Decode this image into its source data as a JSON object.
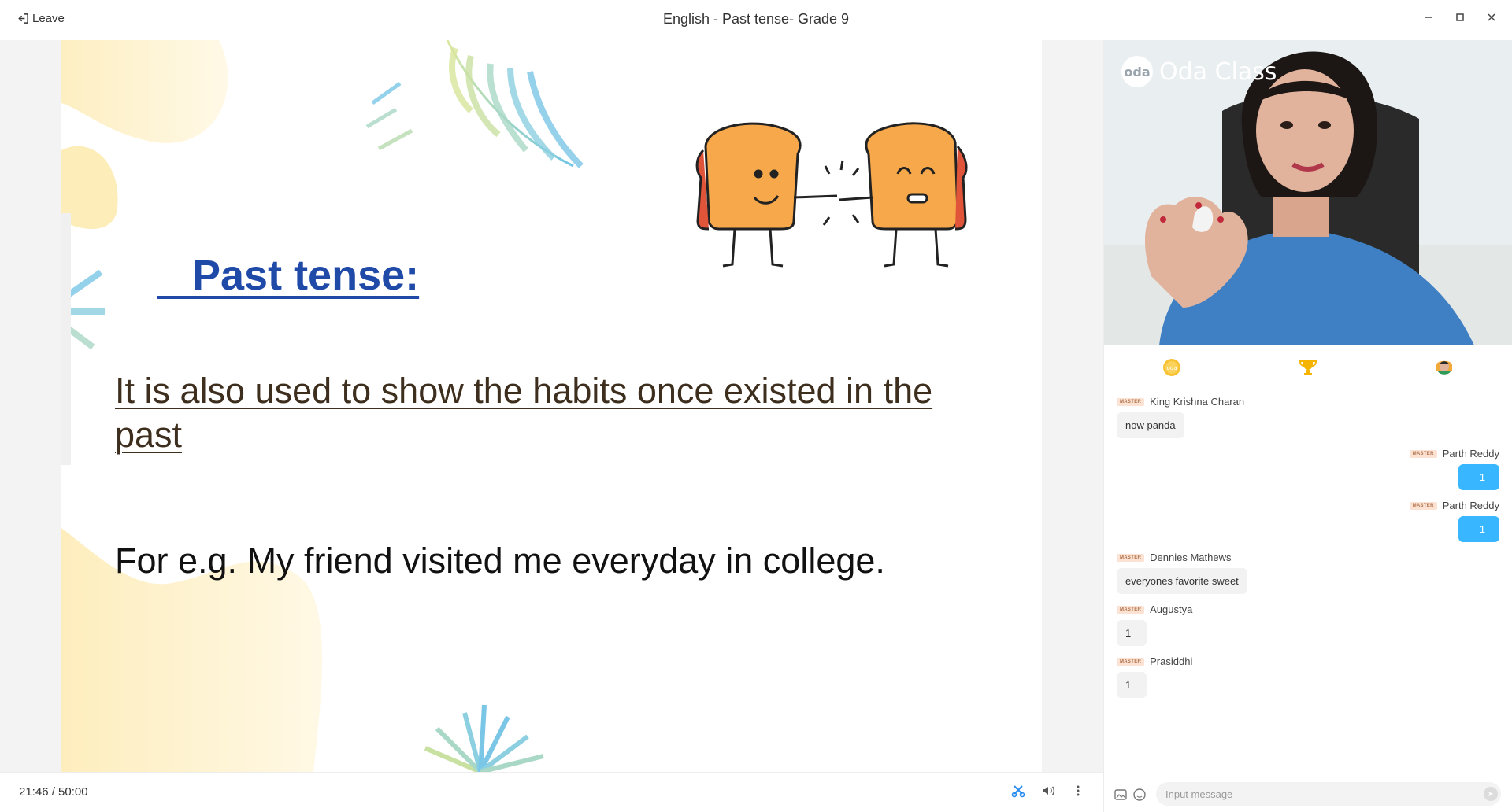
{
  "titlebar": {
    "leave_label": "Leave",
    "title": "English - Past tense- Grade 9"
  },
  "slide": {
    "heading": "   Past tense:",
    "body": " It is also used to show the habits once existed in the past",
    "example": "For e.g. My friend visited me everyday in college."
  },
  "bottombar": {
    "timer": "21:46  / 50:00"
  },
  "video": {
    "brand_logo": "oda",
    "brand_name": "Oda Class"
  },
  "tabs": [
    {
      "icon": "coin-icon"
    },
    {
      "icon": "trophy-icon"
    },
    {
      "icon": "medal-avatar-icon"
    }
  ],
  "chat": {
    "messages": [
      {
        "badge": "MASTER",
        "name": "King Krishna Charan",
        "text": "now panda",
        "side": "left"
      },
      {
        "badge": "MASTER",
        "name": "Parth Reddy",
        "text": "1",
        "side": "right"
      },
      {
        "badge": "MASTER",
        "name": "Parth Reddy",
        "text": "1",
        "side": "right"
      },
      {
        "badge": "MASTER",
        "name": "Dennies Mathews",
        "text": "everyones favorite sweet",
        "side": "left"
      },
      {
        "badge": "MASTER",
        "name": "Augustya",
        "text": "1",
        "side": "left"
      },
      {
        "badge": "MASTER",
        "name": "Prasiddhi",
        "text": "1",
        "side": "left"
      }
    ],
    "input_placeholder": "Input message"
  },
  "colors": {
    "heading_blue": "#1f4aa8",
    "bubble_blue": "#38b6ff",
    "badge_bg": "#fbe2d3"
  }
}
